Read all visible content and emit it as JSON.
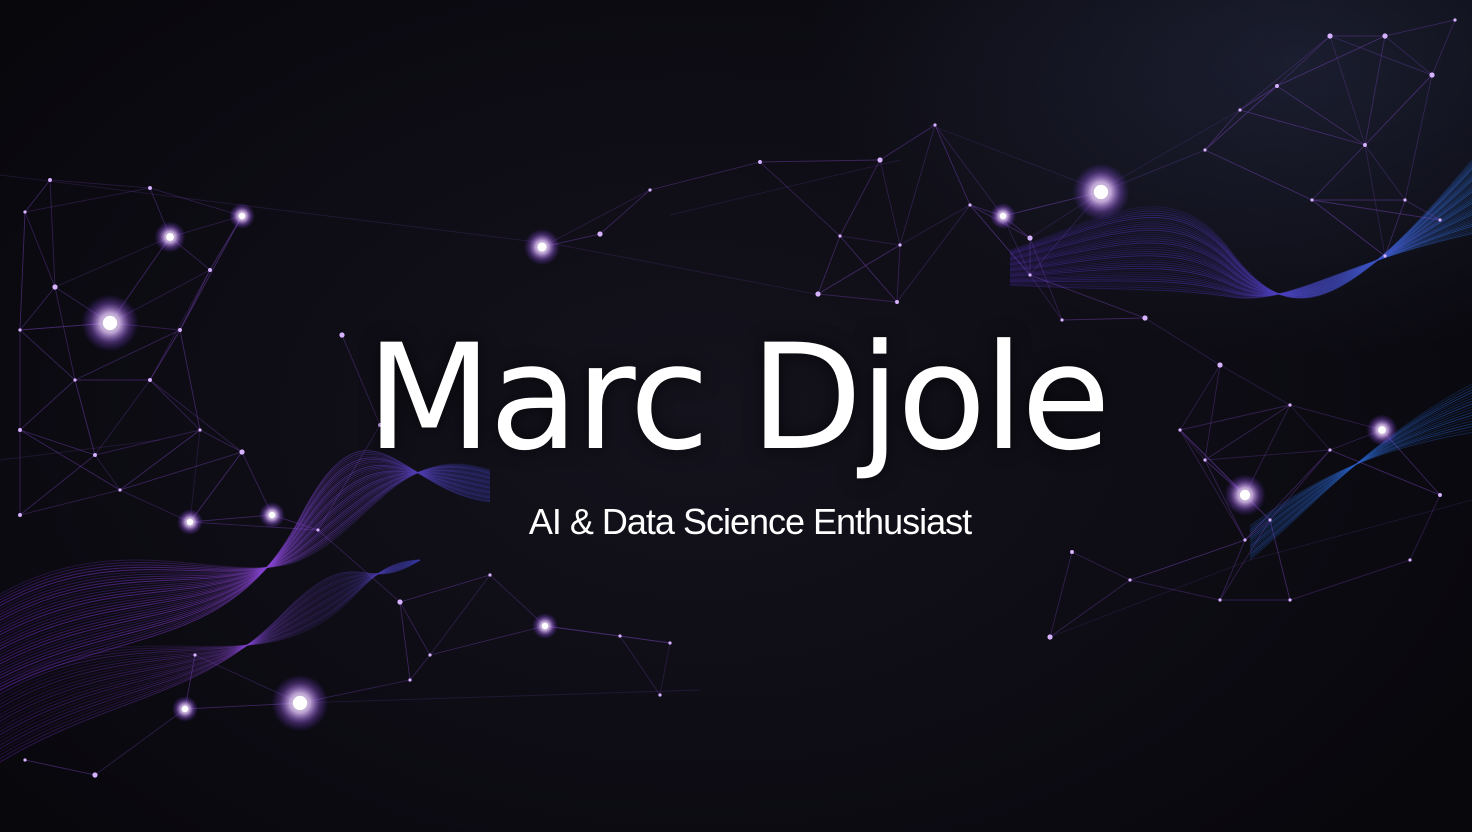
{
  "hero": {
    "name": "Marc Djole",
    "tagline": "AI & Data Science Enthusiast"
  },
  "colors": {
    "background": "#0b0a12",
    "node_glow": "#c78bff",
    "line_purple": "#8a4fd8",
    "wave_purple": "#8b3fe0",
    "wave_blue": "#3c6ee8",
    "text": "#ffffff"
  }
}
